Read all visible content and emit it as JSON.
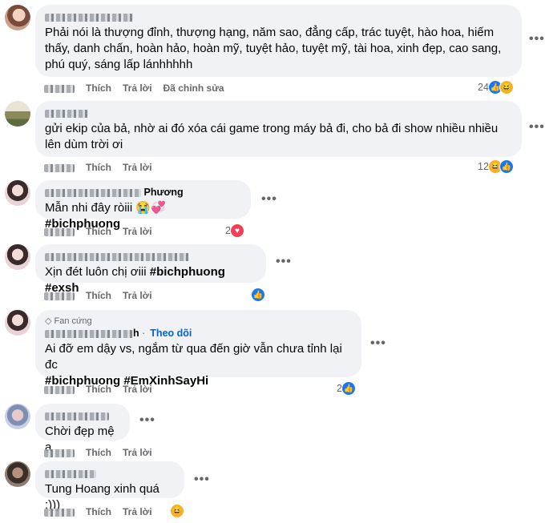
{
  "labels": {
    "like": "Thích",
    "reply": "Trả lời",
    "edited": "Đã chỉnh sửa",
    "follow": "Theo dõi",
    "fan_badge": "Fan cứng"
  },
  "comments": [
    {
      "text": "Phải nói là thượng đỉnh, thượng hạng, năm sao, đẳng cấp, trác tuyệt, hào hoa, hiếm thấy, danh chấn, hoàn hảo, hoàn mỹ, tuyệt hảo, tuyệt mỹ, tài hoa, xinh đẹp, cao sang, phú quý, sáng lấp lánhhhhh",
      "reaction_count": "24",
      "reactions": [
        "like-icon",
        "haha-icon"
      ]
    },
    {
      "text": "gửi ekip của bả, nhờ ai đó xóa cái game trong máy bả đi, cho bả đi show nhiều nhiều lên dùm trời ơi",
      "reaction_count": "12",
      "reactions": [
        "haha-icon",
        "like-icon"
      ]
    },
    {
      "name_suffix": "Phương",
      "text": "Mẫn nhi đây ròiii 😭💞 ",
      "hashtag": "#bichphuong",
      "reaction_count": "2",
      "reactions": [
        "love-icon"
      ]
    },
    {
      "text": "Xịn đét luôn chị ơiii ",
      "hashtag": "#bichphuong #exsh",
      "reaction_count": "",
      "reactions": [
        "like-icon"
      ]
    },
    {
      "name_suffix": "h",
      "text": "Ai đỡ em dậy vs, ngắm từ qua đến giờ vẫn chưa tỉnh lại đc",
      "hashtag": "#bichphuong #EmXinhSayHi",
      "reaction_count": "2",
      "reactions": [
        "like-icon"
      ]
    },
    {
      "text": "Chời đẹp mệ ạ",
      "reaction_count": "",
      "reactions": []
    },
    {
      "text": "Tung Hoang xinh quá :)))",
      "reaction_count": "",
      "reactions": [
        "haha-icon"
      ]
    }
  ],
  "more_glyph": "•••"
}
